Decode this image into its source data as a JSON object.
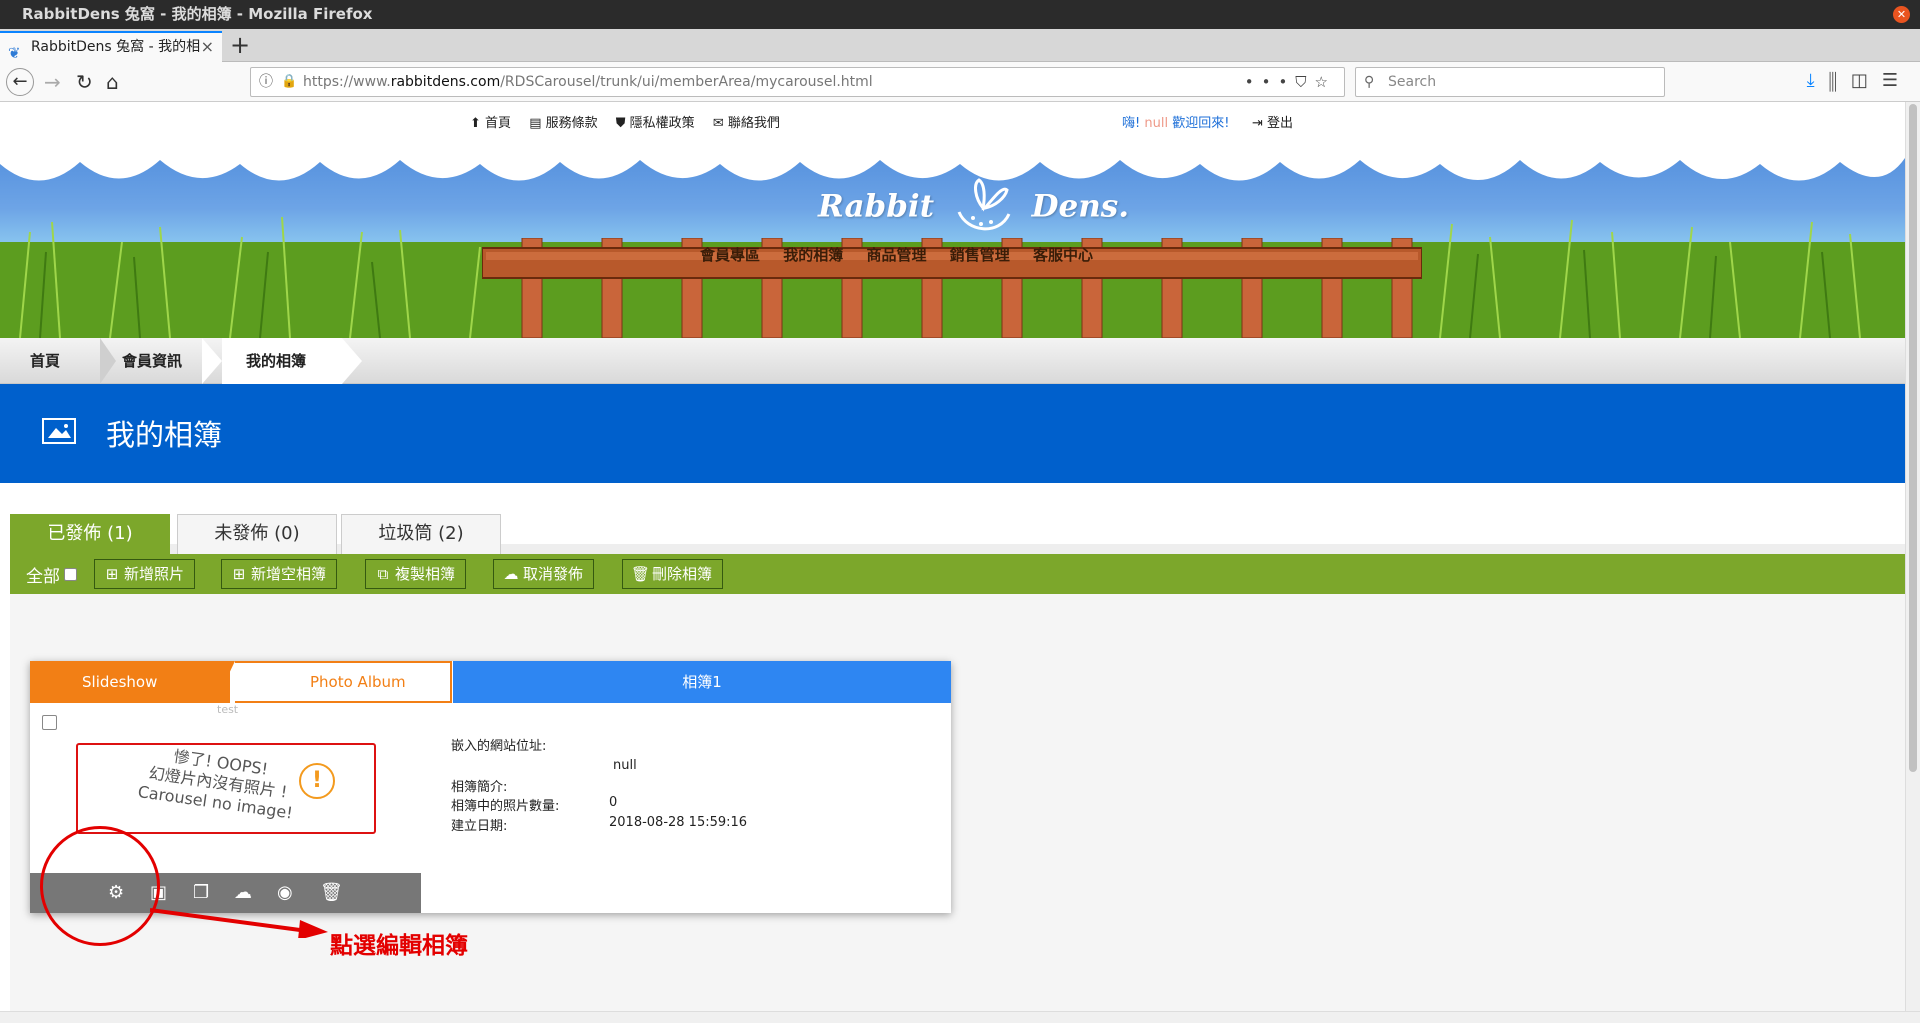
{
  "browser": {
    "window_title": "RabbitDens 兔窩 - 我的相簿 - Mozilla Firefox",
    "tab_title": "RabbitDens 兔窩 - 我的相",
    "url_prefix": "https://www.",
    "url_host": "rabbitdens.com",
    "url_path": "/RDSCarousel/trunk/ui/memberArea/mycarousel.html",
    "search_placeholder": "Search"
  },
  "site": {
    "topnav": [
      "首頁",
      "服務條款",
      "隱私權政策",
      "聯絡我們"
    ],
    "greeting_prefix": "嗨!",
    "greeting_user": "null",
    "greeting_suffix": "歡迎回來!",
    "logout": "登出",
    "logo_left": "Rabbit",
    "logo_right": "Dens.",
    "fence_menu": [
      "會員專區",
      "我的相簿",
      "商品管理",
      "銷售管理",
      "客服中心"
    ]
  },
  "breadcrumb": {
    "home": "首頁",
    "member": "會員資訊",
    "current": "我的相簿"
  },
  "page_title": "我的相簿",
  "tabs": {
    "published": "已發佈 (1)",
    "unpublished": "未發佈 (0)",
    "trash": "垃圾筒 (2)"
  },
  "actions": {
    "select_all": "全部",
    "add_photo": "新增照片",
    "add_empty_album": "新增空相簿",
    "copy_album": "複製相簿",
    "unpublish": "取消發佈",
    "delete_album": "刪除相簿"
  },
  "album": {
    "slideshow": "Slideshow",
    "photo_album": "Photo Album",
    "title": "相簿1",
    "tag": "test",
    "oops_line1": "慘了! OOPS!",
    "oops_line2": "幻燈片內沒有照片 !",
    "oops_line3": "Carousel no image!",
    "embed_label": "嵌入的網站位址:",
    "embed_value": "null",
    "intro_label": "相簿簡介:",
    "count_label": "相簿中的照片數量:",
    "count_value": "0",
    "created_label": "建立日期:",
    "created_value": "2018-08-28 15:59:16",
    "tools": [
      "gear-icon",
      "image-edit-icon",
      "copy-icon",
      "cloud-download-icon",
      "eye-icon",
      "trash-icon"
    ]
  },
  "annotation": {
    "text": "點選編輯相簿",
    "color": "#e30000"
  },
  "colors": {
    "green": "#7ca72b",
    "blue_band": "#0060cc",
    "orange": "#f27f15",
    "album_blue": "#2e86f2"
  }
}
